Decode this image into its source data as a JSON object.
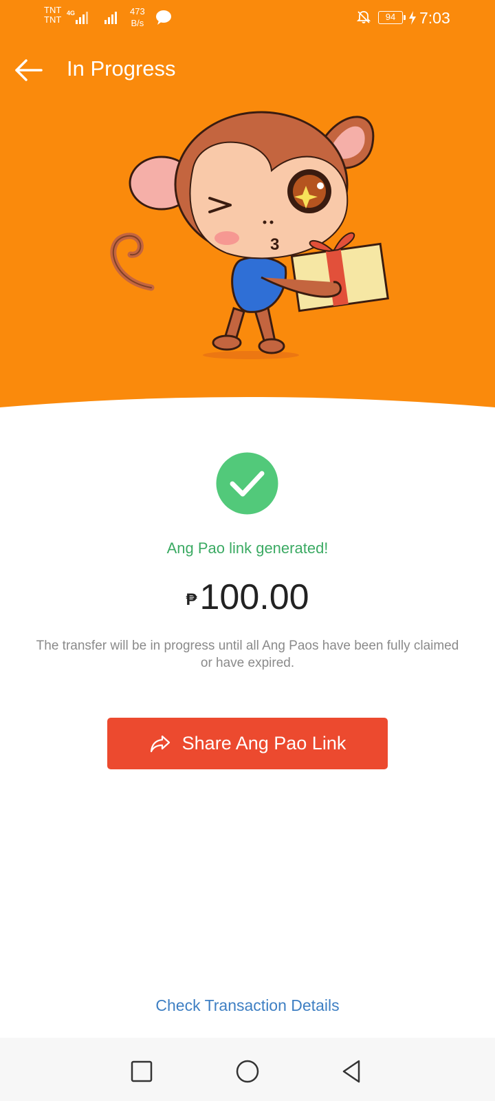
{
  "status_bar": {
    "carrier_1": "TNT",
    "carrier_2": "TNT",
    "network": "4G",
    "speed_value": "473",
    "speed_unit": "B/s",
    "battery": "94",
    "time": "7:03"
  },
  "header": {
    "title": "In Progress"
  },
  "result": {
    "message": "Ang Pao link generated!",
    "currency_symbol": "₱",
    "amount": "100.00",
    "description": "The transfer will be in progress until all Ang Paos have been fully claimed or have expired."
  },
  "actions": {
    "share_label": "Share Ang Pao Link",
    "details_label": "Check Transaction Details"
  },
  "colors": {
    "header_bg": "#FA8A0C",
    "success_green": "#52C97A",
    "share_button": "#EC4A2F",
    "link_blue": "#3E7FC3"
  },
  "icons": {
    "back": "arrow-left-icon",
    "success": "checkmark-circle-icon",
    "share": "share-arrow-icon",
    "nav_recent": "square-icon",
    "nav_home": "circle-icon",
    "nav_back": "triangle-back-icon"
  }
}
